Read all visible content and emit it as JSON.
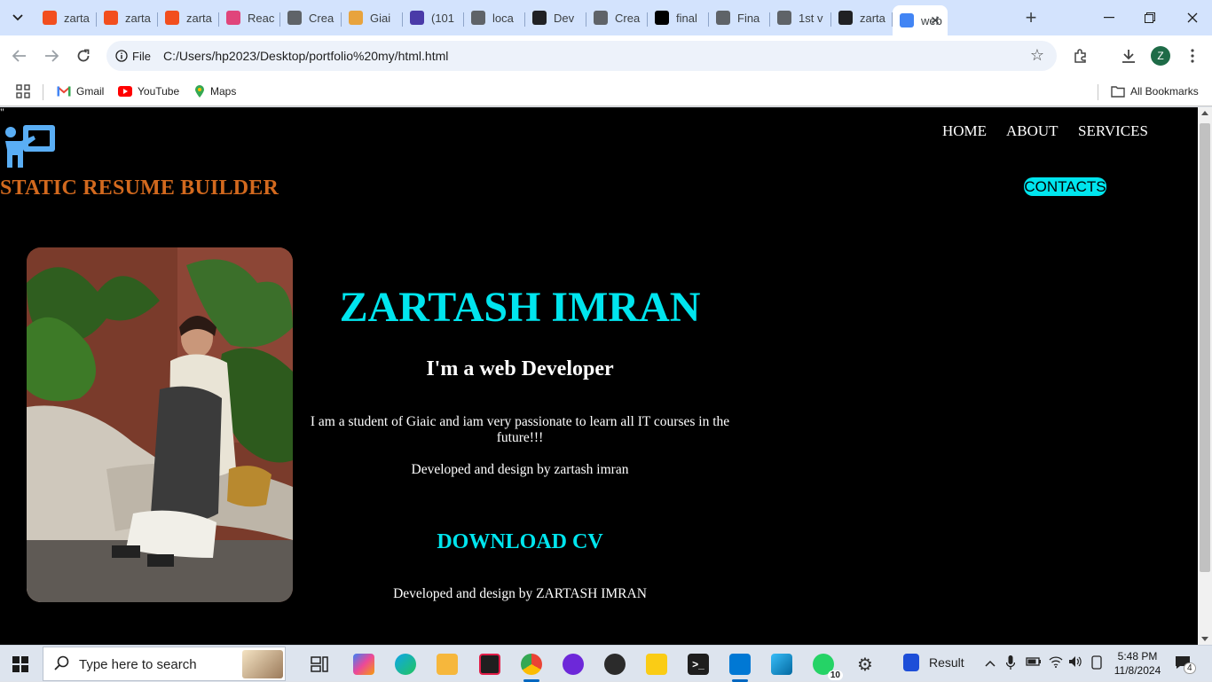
{
  "browser": {
    "tabs": [
      {
        "title": "zarta",
        "icon": "figma-icon",
        "color": "#f24e1e"
      },
      {
        "title": "zarta",
        "icon": "figma-icon",
        "color": "#f24e1e"
      },
      {
        "title": "zarta",
        "icon": "figma-icon",
        "color": "#f24e1e"
      },
      {
        "title": "Reac",
        "icon": "react-icon",
        "color": "#e0457b"
      },
      {
        "title": "Crea",
        "icon": "globe-icon",
        "color": "#5f6368"
      },
      {
        "title": "Giai",
        "icon": "giaic-icon",
        "color": "#e8a33d"
      },
      {
        "title": "(101",
        "icon": "notification-icon",
        "color": "#4a3aa8"
      },
      {
        "title": "loca",
        "icon": "globe-icon",
        "color": "#5f6368"
      },
      {
        "title": "Dev",
        "icon": "dev-icon",
        "color": "#202124"
      },
      {
        "title": "Crea",
        "icon": "globe-icon",
        "color": "#5f6368"
      },
      {
        "title": "final",
        "icon": "vercel-icon",
        "color": "#000000"
      },
      {
        "title": "Fina",
        "icon": "globe-icon",
        "color": "#5f6368"
      },
      {
        "title": "1st v",
        "icon": "globe-icon",
        "color": "#5f6368"
      },
      {
        "title": "zarta",
        "icon": "github-icon",
        "color": "#202124"
      },
      {
        "title": "web",
        "icon": "google-icon",
        "color": "#4285f4"
      }
    ],
    "active_tab_close": "✕",
    "new_tab": "+",
    "address": {
      "chip_label": "File",
      "url": "C:/Users/hp2023/Desktop/portfolio%20my/html.html"
    },
    "profile_initial": "Z",
    "bookmarks": [
      {
        "label": "Gmail",
        "icon": "gmail-icon"
      },
      {
        "label": "YouTube",
        "icon": "youtube-icon"
      },
      {
        "label": "Maps",
        "icon": "maps-icon"
      }
    ],
    "all_bookmarks": "All Bookmarks"
  },
  "page": {
    "stray_char": "\"",
    "site_title": "STATIC RESUME BUILDER",
    "nav": {
      "home": "HOME",
      "about": "ABOUT",
      "services": "SERVICES",
      "contacts": "CONTACTS"
    },
    "name": "ZARTASH IMRAN",
    "role": "I'm a web Developer",
    "intro": "I am a student of Giaic and iam very passionate to learn all IT courses in the future!!!",
    "credit_1": "Developed and design by zartash imran",
    "download_cv": "DOWNLOAD CV",
    "credit_2": "Developed and design by ZARTASH IMRAN",
    "colors": {
      "background": "#000000",
      "accent_cyan": "#00e5ee",
      "title_orange": "#d2691e"
    }
  },
  "taskbar": {
    "search_placeholder": "Type here to search",
    "weather_label": "Result",
    "time": "5:48 PM",
    "date": "11/8/2024",
    "whatsapp_badge": "10",
    "notification_badge": "4"
  }
}
